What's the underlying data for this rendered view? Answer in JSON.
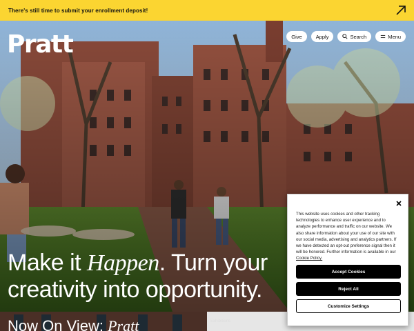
{
  "banner": {
    "text": "There's still time to submit your enrollment deposit!",
    "icon": "arrow-up-right-icon"
  },
  "header": {
    "logo": "Pratt",
    "nav": {
      "give": "Give",
      "apply": "Apply",
      "search": "Search",
      "menu": "Menu"
    }
  },
  "hero": {
    "headline_part1": "Make it ",
    "headline_italic": "Happen",
    "headline_part2": ". Turn your creativity into opportunity."
  },
  "section": {
    "title_plain": "Now On View: ",
    "title_italic": "Pratt",
    "tag": "Exhibitions"
  },
  "cookie": {
    "text": "This website uses cookies and other tracking technologies to enhance user experience and to analyze performance and traffic on our website. We also share information about your use of our site with our social media, advertising and analytics partners. If we have detected an opt-out preference signal then it will be honored. Further information is available in our ",
    "link": "Cookie Policy.",
    "accept": "Accept Cookies",
    "reject": "Reject All",
    "customize": "Customize Settings"
  },
  "colors": {
    "banner": "#fbd531",
    "button_dark": "#000000"
  }
}
